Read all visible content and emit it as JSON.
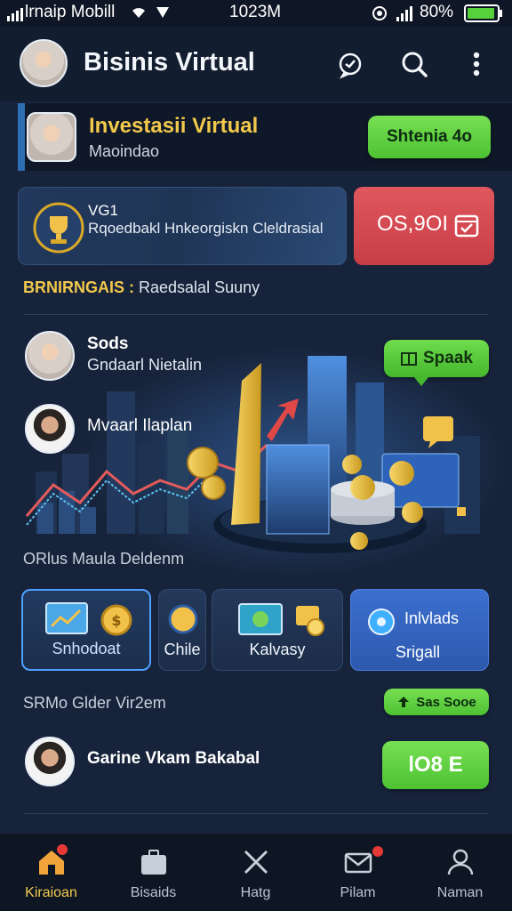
{
  "status_bar": {
    "carrier": "lrnaip Mobill",
    "time": "1023M",
    "battery": "80%"
  },
  "header": {
    "title": "Bisinis Virtual"
  },
  "invest_banner": {
    "title": "Investasii Virtual",
    "subtitle": "Maoindao",
    "button_label": "Shtenia 4o"
  },
  "promo": {
    "code": "VG1",
    "text": "Rqoedbakl Hnkeorgiskn Cleldrasial",
    "value": "OS,9OI"
  },
  "section": {
    "highlight": "BRNIRNGAIS :",
    "rest": "Raedsalal Suuny"
  },
  "people": [
    {
      "name": "Sods",
      "subtitle": "Gndaarl Nietalin"
    },
    {
      "name": "Mvaarl Ilaplan",
      "subtitle": ""
    }
  ],
  "speak_label": "Spaak",
  "caption_1": "ORlus Maula Deldenm",
  "features": [
    {
      "label": "Snhodoat"
    },
    {
      "label": "Chile"
    },
    {
      "label": "Kalvasy"
    },
    {
      "label_line1": "Inlvlads",
      "label_line2": "Srigall"
    }
  ],
  "caption_2": "SRMo Glder Vir2em",
  "small_button_label": "Sas Sooe",
  "bottom_person": {
    "name": "Garine Vkam Bakabal"
  },
  "bottom_button_label": "lO8 E",
  "nav": [
    {
      "label": "Kiraioan",
      "active": true
    },
    {
      "label": "Bisaids",
      "active": false
    },
    {
      "label": "Hatg",
      "active": false
    },
    {
      "label": "Pilam",
      "active": false
    },
    {
      "label": "Naman",
      "active": false
    }
  ],
  "colors": {
    "background": "#17233a",
    "accent_yellow": "#f2c94c",
    "accent_green": "#5bcf3c",
    "accent_red": "#d84a52",
    "accent_blue": "#3b6fd0"
  }
}
